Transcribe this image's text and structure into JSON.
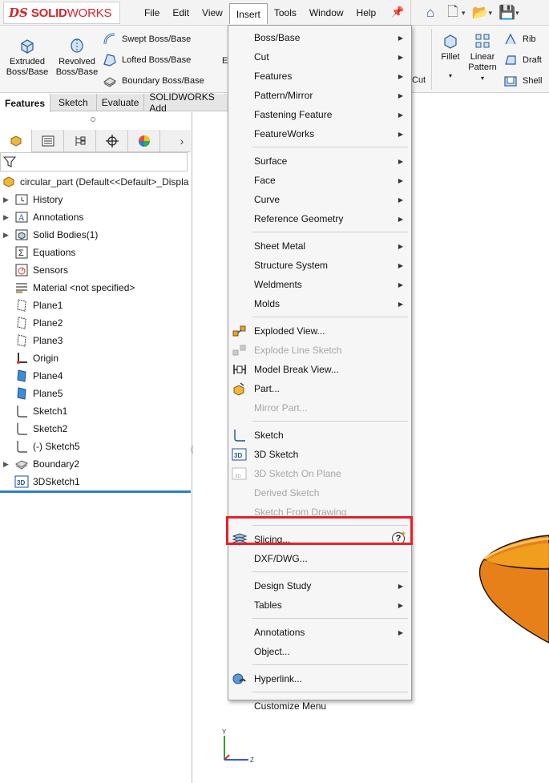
{
  "app": {
    "logo_ds": "DS",
    "logo_solid": "SOLID",
    "logo_works": "WORKS"
  },
  "menubar": {
    "items": [
      "File",
      "Edit",
      "View",
      "Insert",
      "Tools",
      "Window",
      "Help"
    ],
    "active": "Insert"
  },
  "ribbon": {
    "extruded": "Extruded\nBoss/Base",
    "revolved": "Revolved\nBoss/Base",
    "swept": "Swept Boss/Base",
    "lofted": "Lofted Boss/Base",
    "boundary": "Boundary Boss/Base",
    "e_partial": "E",
    "cut_partial": "Cut",
    "fillet": "Fillet",
    "linear_pattern": "Linear\nPattern",
    "rib": "Rib",
    "draft": "Draft",
    "shell": "Shell"
  },
  "command_tabs": [
    "Features",
    "Sketch",
    "Evaluate",
    "SOLIDWORKS Add"
  ],
  "feature_tree": {
    "root": "circular_part  (Default<<Default>_Displa",
    "items": [
      {
        "label": "History",
        "expand": true,
        "icon": "history-folder-icon"
      },
      {
        "label": "Annotations",
        "expand": true,
        "icon": "annotations-icon"
      },
      {
        "label": "Solid Bodies(1)",
        "expand": true,
        "icon": "solid-bodies-icon"
      },
      {
        "label": "Equations",
        "expand": false,
        "icon": "equations-icon"
      },
      {
        "label": "Sensors",
        "expand": false,
        "icon": "sensors-icon"
      },
      {
        "label": "Material <not specified>",
        "expand": false,
        "icon": "material-icon"
      },
      {
        "label": "Plane1",
        "expand": false,
        "icon": "plane-icon"
      },
      {
        "label": "Plane2",
        "expand": false,
        "icon": "plane-icon"
      },
      {
        "label": "Plane3",
        "expand": false,
        "icon": "plane-icon"
      },
      {
        "label": "Origin",
        "expand": false,
        "icon": "origin-icon"
      },
      {
        "label": "Plane4",
        "expand": false,
        "icon": "plane-filled-icon"
      },
      {
        "label": "Plane5",
        "expand": false,
        "icon": "plane-filled-icon"
      },
      {
        "label": "Sketch1",
        "expand": false,
        "icon": "sketch-icon"
      },
      {
        "label": "Sketch2",
        "expand": false,
        "icon": "sketch-icon"
      },
      {
        "label": "(-) Sketch5",
        "expand": false,
        "icon": "sketch-icon"
      },
      {
        "label": "Boundary2",
        "expand": true,
        "icon": "boundary-feature-icon"
      },
      {
        "label": "3DSketch1",
        "expand": false,
        "icon": "3d-sketch-icon"
      }
    ]
  },
  "insert_menu": {
    "items": [
      {
        "label": "Boss/Base",
        "submenu": true
      },
      {
        "label": "Cut",
        "submenu": true
      },
      {
        "label": "Features",
        "submenu": true
      },
      {
        "label": "Pattern/Mirror",
        "submenu": true
      },
      {
        "label": "Fastening Feature",
        "submenu": true
      },
      {
        "label": "FeatureWorks",
        "submenu": true
      },
      {
        "label": "Surface",
        "submenu": true
      },
      {
        "label": "Face",
        "submenu": true
      },
      {
        "label": "Curve",
        "submenu": true
      },
      {
        "label": "Reference Geometry",
        "submenu": true
      },
      {
        "label": "Sheet Metal",
        "submenu": true
      },
      {
        "label": "Structure System",
        "submenu": true
      },
      {
        "label": "Weldments",
        "submenu": true
      },
      {
        "label": "Molds",
        "submenu": true
      },
      {
        "label": "Exploded View...",
        "icon": "exploded-view-icon"
      },
      {
        "label": "Explode Line Sketch",
        "disabled": true,
        "icon": "explode-line-sketch-icon"
      },
      {
        "label": "Model Break View...",
        "icon": "model-break-view-icon"
      },
      {
        "label": "Part...",
        "icon": "insert-part-icon"
      },
      {
        "label": "Mirror Part...",
        "disabled": true
      },
      {
        "label": "Sketch",
        "icon": "sketch-icon"
      },
      {
        "label": "3D Sketch",
        "icon": "3d-sketch-icon"
      },
      {
        "label": "3D Sketch On Plane",
        "disabled": true,
        "icon": "3d-sketch-on-plane-icon"
      },
      {
        "label": "Derived Sketch",
        "disabled": true
      },
      {
        "label": "Sketch From Drawing",
        "disabled": true
      },
      {
        "label": "Slicing...",
        "icon": "slicing-icon",
        "help": "?"
      },
      {
        "label": "DXF/DWG..."
      },
      {
        "label": "Design Study",
        "submenu": true
      },
      {
        "label": "Tables",
        "submenu": true
      },
      {
        "label": "Annotations",
        "submenu": true
      },
      {
        "label": "Object..."
      },
      {
        "label": "Hyperlink...",
        "icon": "hyperlink-icon"
      },
      {
        "label": "Customize Menu"
      }
    ]
  },
  "triad": {
    "y": "Y",
    "z": "Z"
  },
  "colors": {
    "brand_red": "#d6252b",
    "highlight_red": "#e8202a",
    "part_orange": "#e8801a",
    "accent_blue": "#2d7fc1"
  }
}
